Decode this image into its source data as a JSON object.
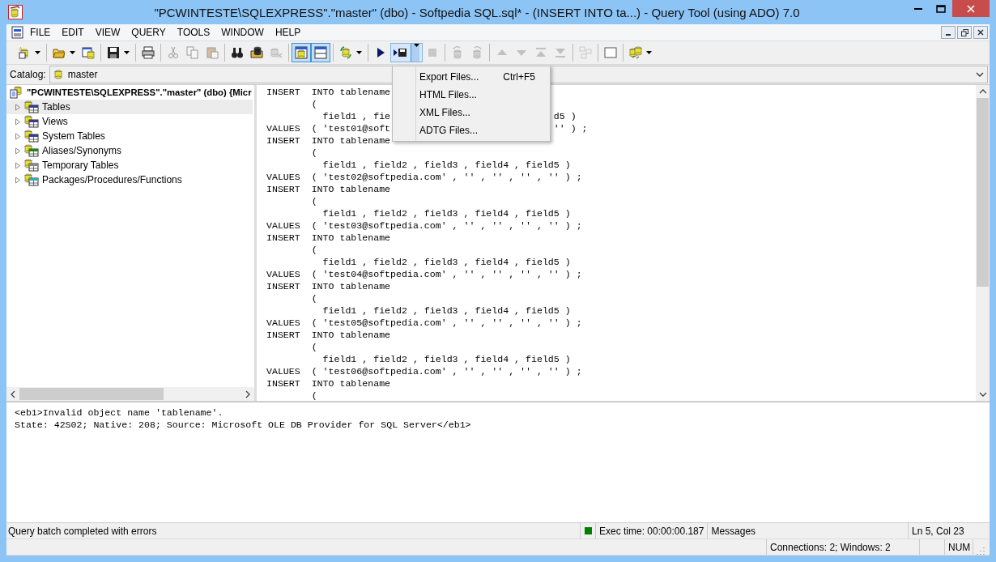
{
  "window": {
    "title": "\"PCWINTESTE\\SQLEXPRESS\".\"master\" (dbo) - Softpedia SQL.sql* - (INSERT  INTO ta...) - Query Tool (using ADO) 7.0"
  },
  "menu_bar": [
    "FILE",
    "EDIT",
    "VIEW",
    "QUERY",
    "TOOLS",
    "WINDOW",
    "HELP"
  ],
  "toolbar": [
    {
      "kind": "new",
      "dropdown": true,
      "disabled": false,
      "on": false,
      "expanded": false
    },
    {
      "kind": "open",
      "dropdown": true,
      "disabled": false,
      "on": false,
      "expanded": false
    },
    {
      "kind": "window_db",
      "dropdown": false,
      "disabled": false,
      "on": false,
      "expanded": false
    },
    {
      "kind": "save",
      "dropdown": true,
      "disabled": false,
      "on": false,
      "expanded": false
    },
    {
      "kind": "print",
      "dropdown": false,
      "disabled": false,
      "on": false,
      "expanded": false
    },
    {
      "kind": "cut",
      "dropdown": false,
      "disabled": true,
      "on": false,
      "expanded": false
    },
    {
      "kind": "copy",
      "dropdown": false,
      "disabled": true,
      "on": false,
      "expanded": false
    },
    {
      "kind": "paste",
      "dropdown": false,
      "disabled": true,
      "on": false,
      "expanded": false
    },
    {
      "kind": "find",
      "dropdown": false,
      "disabled": false,
      "on": false,
      "expanded": false
    },
    {
      "kind": "folder_db",
      "dropdown": false,
      "disabled": false,
      "on": false,
      "expanded": false
    },
    {
      "kind": "db_remove",
      "dropdown": false,
      "disabled": true,
      "on": false,
      "expanded": false
    },
    {
      "kind": "db_panel",
      "dropdown": false,
      "disabled": false,
      "on": true,
      "expanded": false
    },
    {
      "kind": "pane",
      "dropdown": false,
      "disabled": false,
      "on": true,
      "expanded": false
    },
    {
      "kind": "db_refresh",
      "dropdown": true,
      "disabled": false,
      "on": false,
      "expanded": false
    },
    {
      "kind": "run",
      "dropdown": false,
      "disabled": false,
      "on": false,
      "expanded": false
    },
    {
      "kind": "export",
      "dropdown": true,
      "disabled": false,
      "on": false,
      "expanded": true
    },
    {
      "kind": "stop",
      "dropdown": false,
      "disabled": true,
      "on": false,
      "expanded": false
    },
    {
      "kind": "db_undo",
      "dropdown": false,
      "disabled": true,
      "on": false,
      "expanded": false
    },
    {
      "kind": "db_redo",
      "dropdown": false,
      "disabled": true,
      "on": false,
      "expanded": false
    },
    {
      "kind": "up",
      "dropdown": false,
      "disabled": true,
      "on": false,
      "expanded": false
    },
    {
      "kind": "down",
      "dropdown": false,
      "disabled": true,
      "on": false,
      "expanded": false
    },
    {
      "kind": "top",
      "dropdown": false,
      "disabled": true,
      "on": false,
      "expanded": false
    },
    {
      "kind": "bottom",
      "dropdown": false,
      "disabled": true,
      "on": false,
      "expanded": false
    },
    {
      "kind": "diagram",
      "dropdown": false,
      "disabled": true,
      "on": false,
      "expanded": false
    },
    {
      "kind": "blank",
      "dropdown": false,
      "disabled": false,
      "on": false,
      "expanded": false
    },
    {
      "kind": "db_link",
      "dropdown": true,
      "disabled": false,
      "on": false,
      "expanded": false
    }
  ],
  "catalog": {
    "label": "Catalog:",
    "value": "master"
  },
  "export_menu": [
    {
      "label": "Export Files...",
      "shortcut": "Ctrl+F5"
    },
    {
      "label": "HTML Files..."
    },
    {
      "label": "XML Files..."
    },
    {
      "label": "ADTG Files..."
    }
  ],
  "tree": {
    "label": "\"PCWINTESTE\\SQLEXPRESS\".\"master\" (dbo) {Micr",
    "children": [
      {
        "label": "Tables",
        "selected": true,
        "expanded": false
      },
      {
        "label": "Views",
        "selected": false,
        "expanded": false
      },
      {
        "label": "System Tables",
        "selected": false,
        "expanded": false
      },
      {
        "label": "Aliases/Synonyms",
        "selected": false,
        "expanded": false
      },
      {
        "label": "Temporary Tables",
        "selected": false,
        "expanded": false
      },
      {
        "label": "Packages/Procedures/Functions",
        "selected": false,
        "expanded": false
      }
    ]
  },
  "editor_lines": [
    {
      "text": "INSERT  INTO tablename"
    },
    {
      "text": "        ("
    },
    {
      "text": "          field1 , fie",
      "tail": "d5 )"
    },
    {
      "text": "VALUES  ( 'test01@soft",
      "tail": "'' ) ;"
    },
    {
      "text": "INSERT  INTO tablename"
    },
    {
      "text": "        ("
    },
    {
      "text": "          field1 , field2 , field3 , field4 , field5 )"
    },
    {
      "text": "VALUES  ( 'test02@softpedia.com' , '' , '' , '' , '' ) ;"
    },
    {
      "text": "INSERT  INTO tablename"
    },
    {
      "text": "        ("
    },
    {
      "text": "          field1 , field2 , field3 , field4 , field5 )"
    },
    {
      "text": "VALUES  ( 'test03@softpedia.com' , '' , '' , '' , '' ) ;"
    },
    {
      "text": "INSERT  INTO tablename"
    },
    {
      "text": "        ("
    },
    {
      "text": "          field1 , field2 , field3 , field4 , field5 )"
    },
    {
      "text": "VALUES  ( 'test04@softpedia.com' , '' , '' , '' , '' ) ;"
    },
    {
      "text": "INSERT  INTO tablename"
    },
    {
      "text": "        ("
    },
    {
      "text": "          field1 , field2 , field3 , field4 , field5 )"
    },
    {
      "text": "VALUES  ( 'test05@softpedia.com' , '' , '' , '' , '' ) ;"
    },
    {
      "text": "INSERT  INTO tablename"
    },
    {
      "text": "        ("
    },
    {
      "text": "          field1 , field2 , field3 , field4 , field5 )"
    },
    {
      "text": "VALUES  ( 'test06@softpedia.com' , '' , '' , '' , '' ) ;"
    },
    {
      "text": "INSERT  INTO tablename"
    },
    {
      "text": "        ("
    }
  ],
  "messages": [
    "<eb1>Invalid object name 'tablename'.",
    "State: 42S02; Native: 208; Source: Microsoft OLE DB Provider for SQL Server</eb1>"
  ],
  "status_bar": {
    "message": "Query batch completed with errors",
    "exec_time": "Exec time: 00:00:00.187",
    "pane": "Messages",
    "position": "Ln 5, Col 23",
    "connections": "Connections: 2; Windows: 2",
    "num": "NUM"
  }
}
